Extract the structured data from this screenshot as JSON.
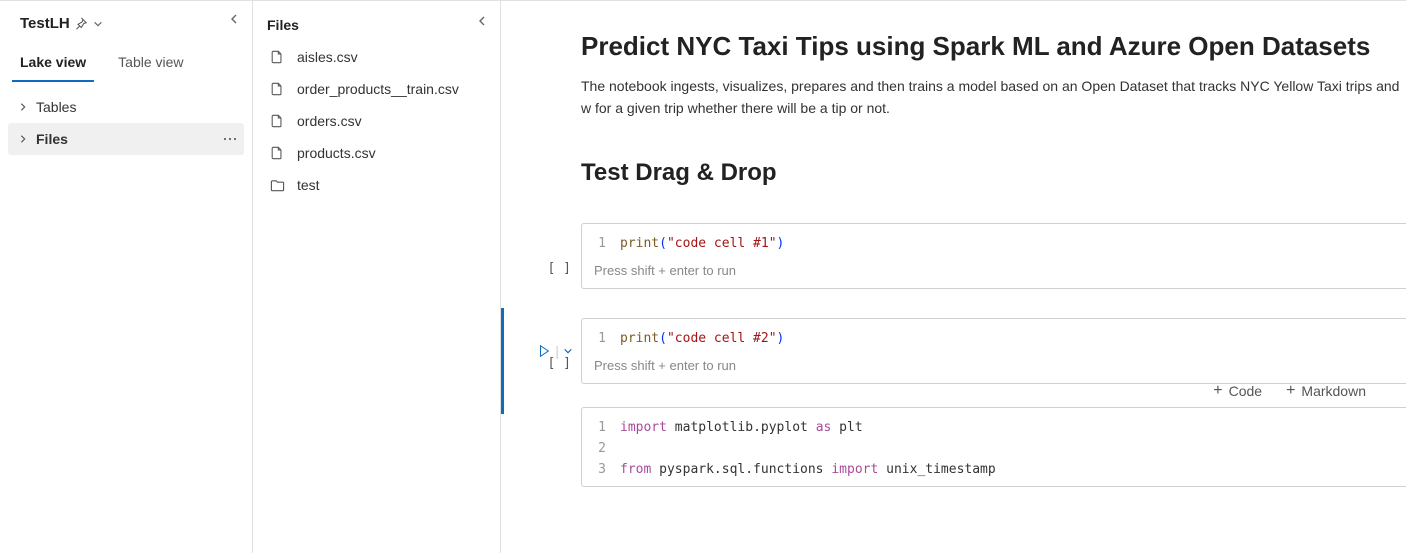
{
  "workspace": {
    "name": "TestLH"
  },
  "tabs": {
    "lake": "Lake view",
    "table": "Table view",
    "active": "lake"
  },
  "tree": {
    "tables": "Tables",
    "files": "Files",
    "selected": "files"
  },
  "filesPanel": {
    "title": "Files",
    "items": [
      {
        "name": "aisles.csv",
        "type": "file"
      },
      {
        "name": "order_products__train.csv",
        "type": "file"
      },
      {
        "name": "orders.csv",
        "type": "file"
      },
      {
        "name": "products.csv",
        "type": "file"
      },
      {
        "name": "test",
        "type": "folder"
      }
    ]
  },
  "notebook": {
    "title": "Predict NYC Taxi Tips using Spark ML and Azure Open Datasets",
    "description": "The notebook ingests, visualizes, prepares and then trains a model based on an Open Dataset that tracks NYC Yellow Taxi trips and w for a given trip whether there will be a tip or not.",
    "subtitle": "Test Drag & Drop",
    "execLabel": "[ ]",
    "runHint": "Press shift + enter to run",
    "addCode": "Code",
    "addMarkdown": "Markdown",
    "cells": [
      {
        "lines": [
          {
            "n": "1",
            "tokens": [
              {
                "t": "print",
                "c": "fn"
              },
              {
                "t": "(",
                "c": "par"
              },
              {
                "t": "\"code cell #1\"",
                "c": "str"
              },
              {
                "t": ")",
                "c": "par"
              }
            ]
          }
        ]
      },
      {
        "lines": [
          {
            "n": "1",
            "tokens": [
              {
                "t": "print",
                "c": "fn"
              },
              {
                "t": "(",
                "c": "par"
              },
              {
                "t": "\"code cell #2\"",
                "c": "str"
              },
              {
                "t": ")",
                "c": "par"
              }
            ]
          }
        ]
      },
      {
        "lines": [
          {
            "n": "1",
            "tokens": [
              {
                "t": "import",
                "c": "kw"
              },
              {
                "t": " ",
                "c": ""
              },
              {
                "t": "matplotlib.pyplot",
                "c": "id"
              },
              {
                "t": " ",
                "c": ""
              },
              {
                "t": "as",
                "c": "kw"
              },
              {
                "t": " ",
                "c": ""
              },
              {
                "t": "plt",
                "c": "id"
              }
            ]
          },
          {
            "n": "2",
            "tokens": []
          },
          {
            "n": "3",
            "tokens": [
              {
                "t": "from",
                "c": "kw"
              },
              {
                "t": " ",
                "c": ""
              },
              {
                "t": "pyspark.sql.functions",
                "c": "id"
              },
              {
                "t": " ",
                "c": ""
              },
              {
                "t": "import",
                "c": "kw"
              },
              {
                "t": " ",
                "c": ""
              },
              {
                "t": "unix_timestamp",
                "c": "id"
              }
            ]
          }
        ]
      }
    ]
  }
}
